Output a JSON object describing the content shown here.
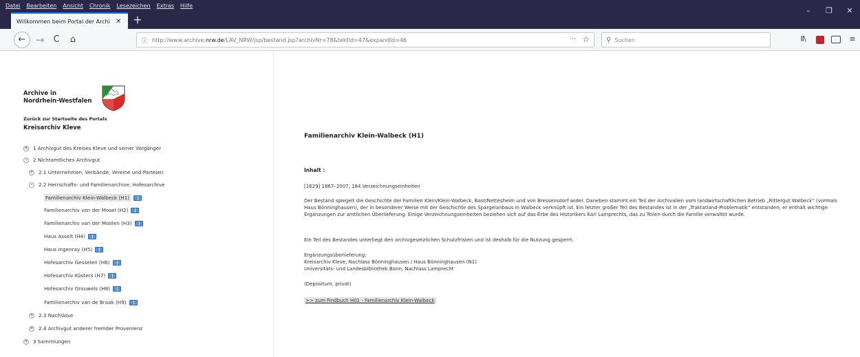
{
  "window": {
    "menu": [
      "Datei",
      "Bearbeiten",
      "Ansicht",
      "Chronik",
      "Lesezeichen",
      "Extras",
      "Hilfe"
    ],
    "controls": {
      "minimize": "–",
      "restore": "❐",
      "close": "✕"
    },
    "tab_title": "Willkommen beim Portal der Archi",
    "tab_close": "✕",
    "new_tab": "+"
  },
  "navbar": {
    "back": "←",
    "forward": "→",
    "reload": "C",
    "home": "⌂",
    "info": "ⓘ",
    "url_prefix": "http://www.archive.",
    "url_domain": "nrw.de",
    "url_path": "/LAV_NRW/jsp/bestand.jsp?archivNr=78&tektId=47&expandId=46",
    "url_more": "···",
    "bookmark_star": "☆",
    "search_icon": "⚲",
    "search_placeholder": "Suchen",
    "library": "II\\",
    "menu_icon": "≡"
  },
  "sidebar": {
    "logo_line1": "Archive in",
    "logo_line2": "Nordrhein-Westfalen",
    "back_link": "Zurück zur Startseite des Portals",
    "archive_title": "Kreisarchiv Kleve",
    "tree": [
      {
        "label": "1 Archivgut des Kreises Kleve und seiner Vorgänger",
        "toggle": "+"
      },
      {
        "label": "2 Nichtamtliches Archivgut",
        "toggle": "–"
      },
      {
        "label": "2.1 Unternehmen, Verbände, Vereine und Parteien",
        "toggle": "+"
      },
      {
        "label": "2.2 Herrschafts- und Familienarchive, Hofesarchive",
        "toggle": "–"
      },
      {
        "label": "2.3 Nachlässe",
        "toggle": "+"
      },
      {
        "label": "2.4 Archivgut anderer fremder Provenienz",
        "toggle": "+"
      },
      {
        "label": "3 Sammlungen",
        "toggle": "+"
      }
    ],
    "leaves": [
      "Familienarchiv Klein-Walbeck (H1)",
      "Familienarchiv von der Mosel (H2)",
      "Familienarchiv van der Moolen (H3)",
      "Haus Asselt (H4)",
      "Haus Ingenray (H5)",
      "Hofesarchiv Gesselen (H6)",
      "Hofesarchiv Küsters (H7)",
      "Hofesarchiv Grouwels (H8)",
      "Familienarchiv van de Braak (H9)"
    ]
  },
  "content": {
    "title": "Familienarchiv Klein-Walbeck (H1)",
    "heading": "Inhalt :",
    "extent": "[1629] 1867–2007, 184 Verzeichnungseinheiten",
    "description": "Der Bestand spiegelt die Geschichte der Familien Klein/Klein-Walbeck, Bast/Nettesheim und von Bressensdorf wider. Daneben stammt ein Teil der Archivalien vom landwirtschaftlichen Betrieb „Rittergut Walbeck“ (vormals Haus Bönninghausen), der in besonderer Weise mit der Geschichte des Spargelanbaus in Walbeck verknüpft ist. Ein letzter großer Teil des Bestandes ist in der „Traktatland-Problematik“ entstanden; er enthält wichtige Ergänzungen zur amtlichen Überlieferung. Einige Verzeichnungseinheiten beziehen sich auf das Erbe des Historikers Karl Lamprechts, das zu Teilen durch die Familie verwaltet wurde.",
    "restriction": "Ein Teil des Bestandes unterliegt den archivgesetzlichen Schutzfristen und ist deshalb für die Nutzung gesperrt.",
    "supplement_heading": "Ergänzungsüberlieferung:",
    "supplement_1": "Kreisarchiv Kleve, Nachlass Bönninghausen / Haus Bönninghausen (N1)",
    "supplement_2": "Universitäts- und Landesbibliothek Bonn, Nachlass Lamprecht",
    "deposit": "(Depositum, privat)",
    "finding_aid_link": ">> zum Findbuch H01 - Familienarchiv Klein-Walbeck"
  },
  "colors": {
    "titlebar": "#2a2748",
    "toolbar": "#f5f6f7",
    "tab_accent": "#0a84ff",
    "selected_bg": "#e3e3e3",
    "book_icon": "#5a95d6"
  }
}
